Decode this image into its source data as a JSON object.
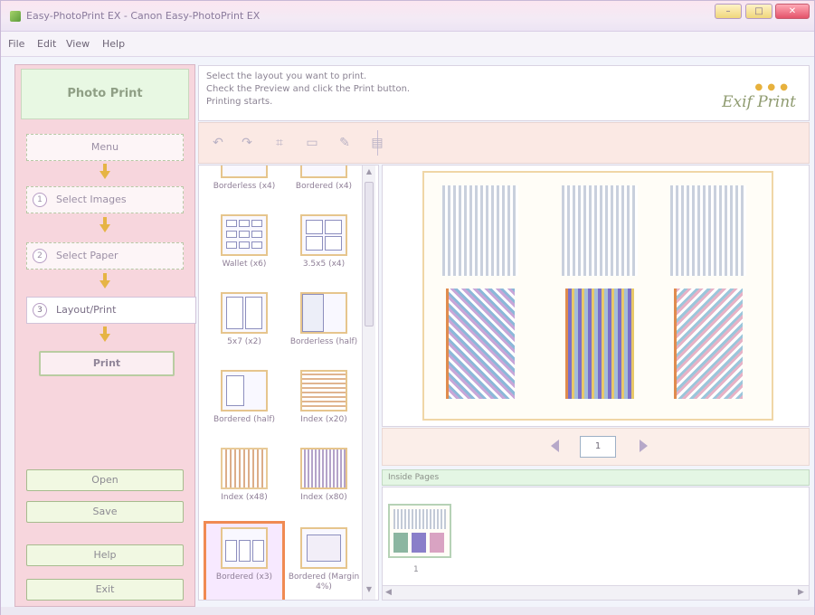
{
  "window": {
    "title": "Easy-PhotoPrint EX - Canon Easy-PhotoPrint EX",
    "min_label": "–",
    "max_label": "□",
    "close_label": "✕"
  },
  "menu": [
    "File",
    "Edit",
    "View",
    "Help"
  ],
  "sidebar": {
    "mode_title": "Photo Print",
    "steps": [
      {
        "num": "",
        "label": "Menu"
      },
      {
        "num": "1",
        "label": "Select Images"
      },
      {
        "num": "2",
        "label": "Select Paper"
      },
      {
        "num": "3",
        "label": "Layout/Print"
      }
    ],
    "print_label": "Print",
    "open_label": "Open",
    "save_label": "Save",
    "help_label": "Help",
    "exit_label": "Exit"
  },
  "instructions": {
    "line1": "Select the layout you want to print.",
    "line2": "Check the Preview and click the Print button.",
    "line3": "Printing starts.",
    "logo": "Exif Print"
  },
  "toolbar": {
    "icons": [
      "rotate-left-icon",
      "rotate-right-icon",
      "trim-icon",
      "frame-icon",
      "correct-enhance-icon",
      "layout-print-icon"
    ]
  },
  "layouts": [
    {
      "label": "Borderless (x4)",
      "selected": false
    },
    {
      "label": "Bordered (x4)",
      "selected": false
    },
    {
      "label": "Wallet (x6)",
      "selected": false
    },
    {
      "label": "3.5x5 (x4)",
      "selected": false
    },
    {
      "label": "5x7 (x2)",
      "selected": false
    },
    {
      "label": "Borderless (half)",
      "selected": false
    },
    {
      "label": "Bordered (half)",
      "selected": false
    },
    {
      "label": "Index (x20)",
      "selected": false
    },
    {
      "label": "Index (x48)",
      "selected": false
    },
    {
      "label": "Index (x80)",
      "selected": false
    },
    {
      "label": "Bordered (x3)",
      "selected": true
    },
    {
      "label": "Bordered (Margin 4%)",
      "selected": false
    }
  ],
  "pager": {
    "page": "1"
  },
  "pages_panel": {
    "header": "Inside Pages",
    "thumb_label": "1"
  }
}
